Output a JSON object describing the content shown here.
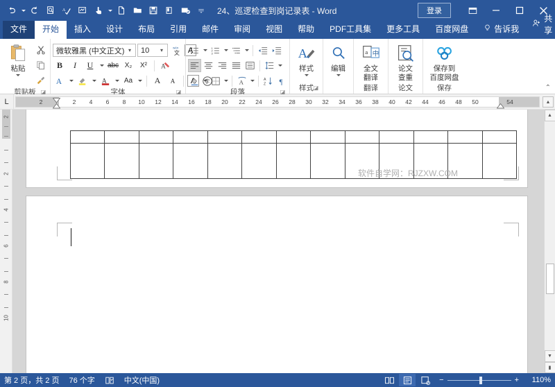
{
  "window": {
    "title": "24、巡逻检查到岗记录表  -  Word",
    "signin_label": "登录",
    "ribbon_display_icon": "ribbon-display-options-icon",
    "minimize_icon": "minimize-icon",
    "maximize_icon": "maximize-icon",
    "close_icon": "close-icon"
  },
  "quick_access": [
    {
      "name": "undo-icon",
      "glyph": "↺",
      "caret": true
    },
    {
      "name": "redo-icon",
      "glyph": "↻",
      "caret": false
    },
    {
      "name": "print-preview-icon",
      "glyph": "⎙",
      "caret": false
    },
    {
      "name": "spelling-check-icon",
      "glyph": "✓",
      "caret": false
    },
    {
      "name": "quick-edit-icon",
      "glyph": "▨",
      "caret": false
    },
    {
      "name": "touch-mode-icon",
      "glyph": "☝",
      "caret": true
    },
    {
      "name": "new-document-icon",
      "glyph": "🗋",
      "caret": false
    },
    {
      "name": "open-file-icon",
      "glyph": "🗁",
      "caret": false
    },
    {
      "name": "save-icon",
      "glyph": "🖫",
      "caret": false
    },
    {
      "name": "format-painter-icon",
      "glyph": "🖉",
      "caret": false
    },
    {
      "name": "email-icon",
      "glyph": "✉",
      "caret": false
    },
    {
      "name": "customize-qat-icon",
      "glyph": "▾",
      "caret": false
    }
  ],
  "tabs": [
    {
      "label": "文件",
      "kind": "file"
    },
    {
      "label": "开始",
      "kind": "active"
    },
    {
      "label": "插入",
      "kind": "normal"
    },
    {
      "label": "设计",
      "kind": "normal"
    },
    {
      "label": "布局",
      "kind": "normal"
    },
    {
      "label": "引用",
      "kind": "normal"
    },
    {
      "label": "邮件",
      "kind": "normal"
    },
    {
      "label": "审阅",
      "kind": "normal"
    },
    {
      "label": "视图",
      "kind": "normal"
    },
    {
      "label": "帮助",
      "kind": "normal"
    },
    {
      "label": "PDF工具集",
      "kind": "normal"
    },
    {
      "label": "更多工具",
      "kind": "normal"
    },
    {
      "label": "百度网盘",
      "kind": "normal"
    },
    {
      "label": "告诉我",
      "kind": "tellme"
    }
  ],
  "share": {
    "label": "共享",
    "icon": "share-person-icon"
  },
  "ribbon": {
    "clipboard": {
      "group_label": "剪贴板",
      "paste_label": "粘贴",
      "buttons": [
        {
          "name": "cut-icon",
          "glyph": "✂"
        },
        {
          "name": "copy-icon",
          "glyph": "⧉"
        },
        {
          "name": "format-painter-icon",
          "glyph": "🖌"
        }
      ]
    },
    "font": {
      "group_label": "字体",
      "font_name": "微软雅黑 (中文正文)",
      "font_size": "10",
      "row1": [
        {
          "name": "phonetic-guide-icon",
          "glyph": "拼"
        },
        {
          "name": "character-border-icon",
          "glyph": "A"
        }
      ],
      "row2": [
        {
          "name": "bold-button",
          "glyph": "B"
        },
        {
          "name": "italic-button",
          "glyph": "I"
        },
        {
          "name": "underline-button",
          "glyph": "U"
        },
        {
          "name": "strikethrough-button",
          "glyph": "abc"
        },
        {
          "name": "subscript-button",
          "glyph": "X₂"
        },
        {
          "name": "superscript-button",
          "glyph": "X²"
        },
        {
          "name": "clear-formatting-button",
          "glyph": "🖉"
        }
      ],
      "row3": [
        {
          "name": "text-effects-button",
          "glyph": "A"
        },
        {
          "name": "text-highlight-color-button",
          "glyph": "ab"
        },
        {
          "name": "font-color-button",
          "glyph": "A"
        },
        {
          "name": "change-case-button",
          "glyph": "Aa"
        },
        {
          "name": "grow-font-button",
          "glyph": "A"
        },
        {
          "name": "shrink-font-button",
          "glyph": "A"
        },
        {
          "name": "character-shading-button",
          "glyph": "A"
        },
        {
          "name": "enclose-character-button",
          "glyph": "字"
        }
      ]
    },
    "paragraph": {
      "group_label": "段落",
      "row1": [
        {
          "name": "bullets-button",
          "glyph": "≔"
        },
        {
          "name": "numbering-button",
          "glyph": "≕"
        },
        {
          "name": "multilevel-list-button",
          "glyph": "≣"
        },
        {
          "name": "decrease-indent-button",
          "glyph": "⇤"
        },
        {
          "name": "increase-indent-button",
          "glyph": "⇥"
        }
      ],
      "row2": [
        {
          "name": "align-left-button",
          "glyph": "≡"
        },
        {
          "name": "align-center-button",
          "glyph": "≡"
        },
        {
          "name": "align-right-button",
          "glyph": "≡"
        },
        {
          "name": "justify-button",
          "glyph": "≡"
        },
        {
          "name": "distributed-button",
          "glyph": "▤"
        },
        {
          "name": "line-spacing-button",
          "glyph": "↕"
        }
      ],
      "row3": [
        {
          "name": "shading-button",
          "glyph": "🪣"
        },
        {
          "name": "borders-button",
          "glyph": "⊞"
        },
        {
          "name": "text-effect-paragraph-button",
          "glyph": "A"
        },
        {
          "name": "sort-button",
          "glyph": "A↓"
        },
        {
          "name": "show-formatting-marks-button",
          "glyph": "¶"
        }
      ]
    },
    "styles": {
      "group_label": "样式",
      "label": "样式",
      "icon": "styles-brush-icon"
    },
    "editing": {
      "group_label": "",
      "label": "编辑",
      "icon": "find-magnifier-icon"
    },
    "translate": {
      "group_label": "翻译",
      "label": "全文\n翻译",
      "line1": "全文",
      "line2": "翻译",
      "icon": "translate-icon"
    },
    "thesis": {
      "group_label": "论文",
      "line1": "论文",
      "line2": "查重",
      "icon": "plagiarism-check-icon"
    },
    "save_group": {
      "group_label": "保存",
      "line1": "保存到",
      "line2": "百度网盘",
      "icon": "baidu-netdisk-icon"
    },
    "collapse_ribbon_icon": "collapse-ribbon-chevron-icon"
  },
  "ruler": {
    "tab_stop_selector": "L",
    "horizontal_numbers": [
      "2",
      "2",
      "4",
      "6",
      "8",
      "10",
      "12",
      "14",
      "16",
      "18",
      "20",
      "22",
      "24",
      "26",
      "28",
      "30",
      "32",
      "34",
      "36",
      "38",
      "40",
      "42",
      "44",
      "46",
      "48",
      "50",
      "54"
    ],
    "left_margin_label": "2",
    "right_margin_label": "54",
    "vertical_numbers": [
      "2",
      "2",
      "4",
      "6",
      "8",
      "10"
    ]
  },
  "document": {
    "watermark": "软件自学网：RJZXW.COM",
    "table": {
      "columns": 13,
      "rows": 2
    },
    "page1_visible": true,
    "page2_visible": true
  },
  "statusbar": {
    "page_info": "第 2 页，共 2 页",
    "word_count": "76 个字",
    "proofing_icon": "proofing-errors-icon",
    "language": "中文(中国)",
    "views": [
      {
        "name": "read-mode-view-button",
        "glyph": "▥",
        "active": false
      },
      {
        "name": "print-layout-view-button",
        "glyph": "▤",
        "active": true
      },
      {
        "name": "web-layout-view-button",
        "glyph": "▣",
        "active": false
      }
    ],
    "zoom_out_label": "−",
    "zoom_in_label": "+",
    "zoom_level": "110%"
  },
  "colors": {
    "brand_blue": "#2b579a",
    "ribbon_bg": "#ffffff",
    "page_bg": "#d6d6d6",
    "table_border": "#404040",
    "watermark": "#b0b0b0"
  }
}
